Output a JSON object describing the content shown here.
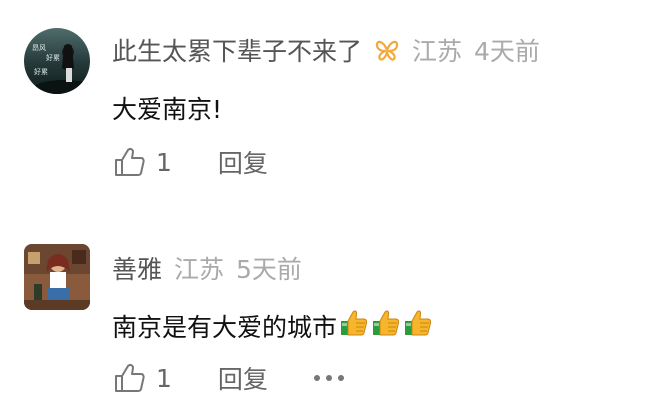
{
  "comments": [
    {
      "username": "此生太累下辈子不来了",
      "badge_icon": "butterfly-badge-icon",
      "location": "江苏",
      "time": "4天前",
      "text": "大爱南京!",
      "emojis": [],
      "likes": "1",
      "reply_label": "回复",
      "more_icon": null,
      "avatar_text": [
        "昂风",
        "好累",
        "好累"
      ]
    },
    {
      "username": "善雅",
      "badge_icon": null,
      "location": "江苏",
      "time": "5天前",
      "text": "南京是有大爱的城市",
      "emojis": [
        "thumbs-up-icon",
        "thumbs-up-icon",
        "thumbs-up-icon"
      ],
      "likes": "1",
      "reply_label": "回复",
      "more_icon": "more-dots-icon",
      "avatar_text": []
    }
  ],
  "colors": {
    "username": "#555555",
    "meta": "#aaaaaa",
    "text": "#111111",
    "action": "#666666",
    "badge": "#f2a93b"
  }
}
